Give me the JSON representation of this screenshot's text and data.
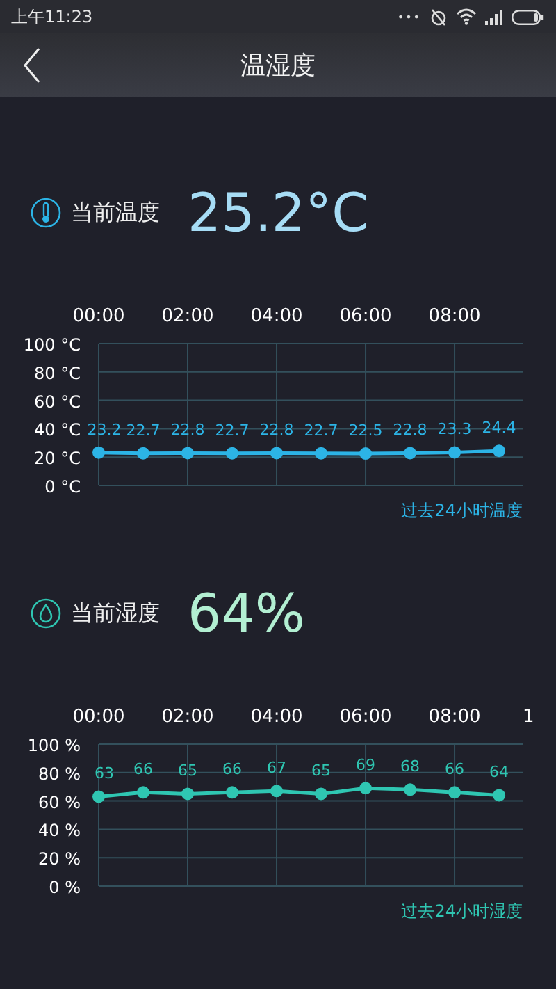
{
  "status_bar": {
    "time": "上午11:23",
    "dots": "•••"
  },
  "header": {
    "title": "温湿度"
  },
  "readings": [
    {
      "kind": "temperature",
      "label": "当前温度",
      "value": "25.2°C",
      "color": "#a6dcf5",
      "chart_data": {
        "type": "line",
        "x": [
          0,
          1,
          2,
          3,
          4,
          5,
          6,
          7,
          8,
          9
        ],
        "xlim": [
          0,
          9.53
        ],
        "grid": true,
        "series": [
          {
            "color": "#2cb4e6",
            "marker": true,
            "values": [
              23.2,
              22.7,
              22.8,
              22.7,
              22.8,
              22.7,
              22.5,
              22.8,
              23.3,
              24.4
            ]
          }
        ],
        "xticks": [
          {
            "value": 0,
            "label": "00:00"
          },
          {
            "value": 2,
            "label": "02:00"
          },
          {
            "value": 4,
            "label": "04:00"
          },
          {
            "value": 6,
            "label": "06:00"
          },
          {
            "value": 8,
            "label": "08:00"
          }
        ],
        "ylim": [
          0,
          100
        ],
        "yticks": [
          {
            "value": 100,
            "label": "100 °C"
          },
          {
            "value": 80,
            "label": "80 °C"
          },
          {
            "value": 60,
            "label": "60 °C"
          },
          {
            "value": 40,
            "label": "40 °C"
          },
          {
            "value": 20,
            "label": "20 °C"
          },
          {
            "value": 0,
            "label": "0 °C"
          }
        ],
        "data_labels": true,
        "annotations": [
          "过去24小时温度"
        ]
      }
    },
    {
      "kind": "humidity",
      "label": "当前湿度",
      "value": "64%",
      "color": "#b2efd2",
      "cut_axis_label": "1",
      "chart_data": {
        "type": "line",
        "x": [
          0,
          1,
          2,
          3,
          4,
          5,
          6,
          7,
          8,
          9
        ],
        "xlim": [
          0,
          9.53
        ],
        "grid": true,
        "series": [
          {
            "color": "#2fc6b2",
            "marker": true,
            "values": [
              63,
              66,
              65,
              66,
              67,
              65,
              69,
              68,
              66,
              64
            ]
          }
        ],
        "xticks": [
          {
            "value": 0,
            "label": "00:00"
          },
          {
            "value": 2,
            "label": "02:00"
          },
          {
            "value": 4,
            "label": "04:00"
          },
          {
            "value": 6,
            "label": "06:00"
          },
          {
            "value": 8,
            "label": "08:00"
          }
        ],
        "ylim": [
          0,
          100
        ],
        "yticks": [
          {
            "value": 100,
            "label": "100 %"
          },
          {
            "value": 80,
            "label": "80 %"
          },
          {
            "value": 60,
            "label": "60 %"
          },
          {
            "value": 40,
            "label": "40 %"
          },
          {
            "value": 20,
            "label": "20 %"
          },
          {
            "value": 0,
            "label": "0 %"
          }
        ],
        "data_labels": true,
        "annotations": [
          "过去24小时湿度"
        ]
      }
    }
  ]
}
